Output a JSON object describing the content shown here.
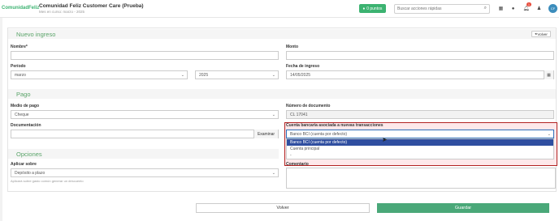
{
  "header": {
    "logo": "ComunidadFeliz",
    "title": "Comunidad Feliz Customer Care (Prueba)",
    "subtitle": "Mes en curso: marzo - 2025",
    "points_label": "0 puntos",
    "search_placeholder": "Buscar acciones rápidas",
    "bell_count": "1",
    "avatar_initials": "CF"
  },
  "nuevo_ingreso": {
    "title": "Nuevo ingreso",
    "back_label": "Volver",
    "nombre_label": "Nombre*",
    "nombre_value": "",
    "monto_label": "Monto",
    "monto_value": "",
    "periodo_label": "Período",
    "periodo_month": "marzo",
    "periodo_year": "2025",
    "fecha_label": "Fecha de ingreso",
    "fecha_value": "14/05/2025"
  },
  "pago": {
    "title": "Pago",
    "medio_label": "Medio de pago",
    "medio_value": "Cheque",
    "numero_label": "Número de documento",
    "numero_value": "CL 17041",
    "documentacion_label": "Documentación",
    "examinar_label": "Examinar",
    "cuenta_label": "Cuenta bancaria asociada a nuevas transacciones",
    "cuenta_value": "Banco BCI (cuenta por defecto)",
    "cuenta_options": [
      "Banco BCI (cuenta por defecto)",
      "Cuenta principal",
      "-"
    ]
  },
  "opciones": {
    "title": "Opciones",
    "aplicar_label": "Aplicar sobre",
    "aplicar_value": "Depósito a plazo",
    "aplicar_hint": "Aplicará sobre gasto común generar un descuento",
    "comentario_label": "Comentario"
  },
  "footer": {
    "volver_label": "Volver",
    "guardar_label": "Guardar"
  },
  "colors": {
    "brand_green": "#3cb371",
    "save_green": "#4aa879",
    "selected_option": "#2f4ea0",
    "highlight_border": "#b22222"
  }
}
